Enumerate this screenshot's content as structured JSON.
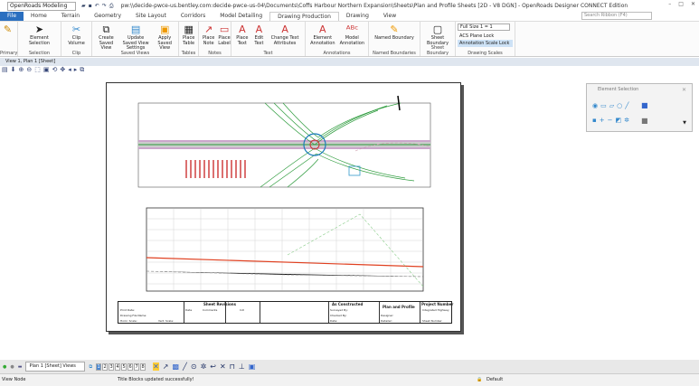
{
  "titlebar": {
    "workflow": "OpenRoads Modeling",
    "path": "pw:\\\\decide-pwce-us.bentley.com:decide-pwce-us-04\\Documents\\Coffs Harbour Northern Expansion\\Sheets\\Plan and Profile Sheets [2D - V8 DGN] - OpenRoads Designer CONNECT Edition",
    "search_placeholder": "Search Ribbon (F4)"
  },
  "tabs": [
    "File",
    "Home",
    "Terrain",
    "Geometry",
    "Site Layout",
    "Corridors",
    "Model Detailing",
    "Drawing Production",
    "Drawing",
    "View"
  ],
  "active_tab": "Drawing Production",
  "ribbon": {
    "groups": [
      {
        "label": "Primary",
        "buttons": []
      },
      {
        "label": "Selection",
        "buttons": [
          "Element Selection"
        ]
      },
      {
        "label": "Clip",
        "buttons": [
          "Clip Volume"
        ]
      },
      {
        "label": "Saved Views",
        "buttons": [
          "Create Saved View",
          "Update Saved View Settings",
          "Apply Saved View"
        ]
      },
      {
        "label": "Tables",
        "buttons": [
          "Place Table"
        ]
      },
      {
        "label": "Notes",
        "buttons": [
          "Place Note",
          "Place Label"
        ]
      },
      {
        "label": "Text",
        "buttons": [
          "Place Text",
          "Edit Text",
          "Change Text Attributes"
        ]
      },
      {
        "label": "Annotations",
        "buttons": [
          "Element Annotation",
          "Model Annotation"
        ]
      },
      {
        "label": "Named Boundaries",
        "buttons": [
          "Named Boundary"
        ]
      },
      {
        "label": "Sheet Boundary",
        "buttons": [
          "Sheet Boundary"
        ]
      }
    ],
    "drawing_scales": {
      "label": "Drawing Scales",
      "scale": "Full Size 1 = 1",
      "acs_lock": "ACS Plane Lock",
      "annotation_lock": "Annotation Scale Lock"
    }
  },
  "view": {
    "title": "View 1, Plan 1 [Sheet]"
  },
  "title_block": {
    "sheet_revisions": "Sheet Revisions",
    "date": "Date",
    "comments": "Comments",
    "init": "Init",
    "as_constructed": "As Constructed",
    "plan_profile": "Plan and Profile",
    "project_number": "Project Number",
    "project_name": "Integrated Highway",
    "left_rows": [
      "Print Date:",
      "Drawing File Name:",
      "Horiz. Scale:",
      "Vert. Scale:"
    ],
    "ac_rows": [
      "Surveyed By:",
      "Checked By:",
      "Date:"
    ],
    "pp_rows": [
      "Designer:",
      "Detailer:"
    ],
    "sheet_number": "Sheet Number"
  },
  "element_selection": {
    "title": "Element Selection"
  },
  "bottom": {
    "view_group": "Plan 1 [Sheet] Views",
    "view_numbers": [
      "1",
      "2",
      "3",
      "4",
      "5",
      "6",
      "7",
      "8"
    ],
    "active_view": "1"
  },
  "status": {
    "left": "View Node",
    "message": "Title Blocks updated successfully!",
    "level": "Default"
  },
  "colors": {
    "accent": "#2a6fc0",
    "profile_line": "#e04020",
    "alignment": "#2a9a3a"
  }
}
